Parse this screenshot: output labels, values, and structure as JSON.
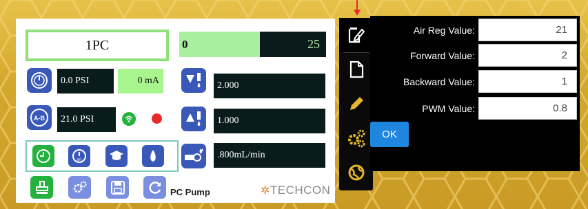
{
  "left_panel": {
    "title": "1PC",
    "progress": {
      "left_text": "0",
      "right_text": "25",
      "fraction": 0.55
    },
    "readouts": [
      {
        "name": "pressure-gauge",
        "value": "0.0 PSI"
      },
      {
        "name": "current",
        "value": "0 mA"
      },
      {
        "name": "ab-pressure",
        "value": "21.0 PSI"
      },
      {
        "name": "dispense-down",
        "value": "2.000"
      },
      {
        "name": "dispense-up",
        "value": "1.000"
      },
      {
        "name": "flow-rate",
        "value": ".800mL/min"
      }
    ],
    "footer_label": "PC Pump",
    "brand": "TECHCON",
    "icons": {
      "gauge": "gauge-icon",
      "ab_gauge": "ab-gauge-icon",
      "wifi": "wifi-icon",
      "status_dot": "status-dot",
      "clock": "clock-icon",
      "int_timer": "int-timer-icon",
      "graduation": "graduation-cap-icon",
      "drop": "drop-icon",
      "syringe": "syringe-icon",
      "settings": "gears-icon",
      "save": "save-icon",
      "refresh": "refresh-icon",
      "pump": "pump-icon"
    },
    "colors": {
      "accent": "#3a58b8",
      "ok_green": "#23b23e",
      "status_red": "#e8282b",
      "value_green": "#a9f58d"
    }
  },
  "sidebar": {
    "items": [
      "edit-document-icon",
      "document-icon",
      "pencil-icon",
      "gears-icon",
      "globe-icon"
    ],
    "active": "edit-document-icon"
  },
  "dialog": {
    "fields": [
      {
        "label": "Air Reg Value:",
        "value": "21"
      },
      {
        "label": "Forward Value:",
        "value": "2"
      },
      {
        "label": "Backward Value:",
        "value": "1"
      },
      {
        "label": "PWM Value:",
        "value": "0.8"
      }
    ],
    "ok_label": "OK"
  }
}
